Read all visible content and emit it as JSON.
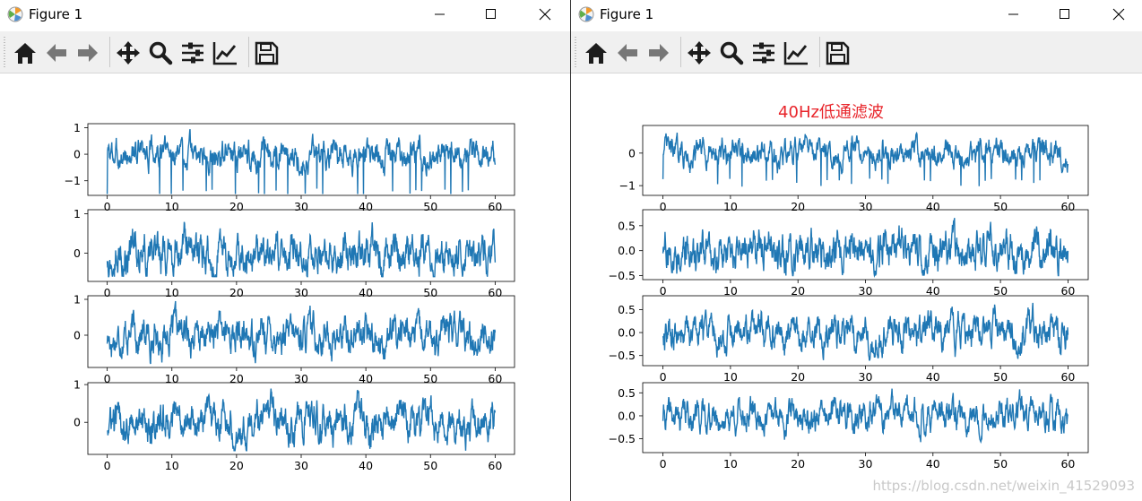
{
  "windows": [
    {
      "title": "Figure 1",
      "figure_title": "",
      "chart_data": [
        {
          "type": "line",
          "title": "",
          "xlabel": "",
          "ylabel": "",
          "xlim": [
            -3,
            63
          ],
          "ylim": [
            -1.55,
            1.15
          ],
          "x_ticks": [
            0,
            10,
            20,
            30,
            40,
            50,
            60
          ],
          "y_ticks": [
            1,
            0,
            -1
          ],
          "y_tick_labels": [
            "1",
            "0",
            "−1"
          ],
          "series": [
            {
              "x_range": [
                0,
                60
              ],
              "approx_min": -1.5,
              "approx_max": 1.0
            }
          ]
        },
        {
          "type": "line",
          "title": "",
          "xlabel": "",
          "ylabel": "",
          "xlim": [
            -3,
            63
          ],
          "ylim": [
            -0.72,
            1.1
          ],
          "x_ticks": [
            0,
            10,
            20,
            30,
            40,
            50,
            60
          ],
          "y_ticks": [
            1,
            0
          ],
          "y_tick_labels": [
            "1",
            "0"
          ],
          "series": [
            {
              "x_range": [
                0,
                60
              ],
              "approx_min": -0.6,
              "approx_max": 0.95
            }
          ]
        },
        {
          "type": "line",
          "title": "",
          "xlabel": "",
          "ylabel": "",
          "xlim": [
            -3,
            63
          ],
          "ylim": [
            -0.9,
            1.1
          ],
          "x_ticks": [
            0,
            10,
            20,
            30,
            40,
            50,
            60
          ],
          "y_ticks": [
            1,
            0
          ],
          "y_tick_labels": [
            "1",
            "0"
          ],
          "series": [
            {
              "x_range": [
                0,
                60
              ],
              "approx_min": -0.8,
              "approx_max": 0.95
            }
          ]
        },
        {
          "type": "line",
          "title": "",
          "xlabel": "",
          "ylabel": "",
          "xlim": [
            -3,
            63
          ],
          "ylim": [
            -0.85,
            1.05
          ],
          "x_ticks": [
            0,
            10,
            20,
            30,
            40,
            50,
            60
          ],
          "y_ticks": [
            1,
            0
          ],
          "y_tick_labels": [
            "1",
            "0"
          ],
          "series": [
            {
              "x_range": [
                0,
                60
              ],
              "approx_min": -0.75,
              "approx_max": 0.95
            }
          ]
        }
      ]
    },
    {
      "title": "Figure 1",
      "figure_title": "40Hz低通滤波",
      "chart_data": [
        {
          "type": "line",
          "title": "40Hz低通滤波",
          "xlabel": "",
          "ylabel": "",
          "xlim": [
            -3,
            63
          ],
          "ylim": [
            -1.3,
            0.85
          ],
          "x_ticks": [
            0,
            10,
            20,
            30,
            40,
            50,
            60
          ],
          "y_ticks": [
            0,
            -1
          ],
          "y_tick_labels": [
            "0",
            "−1"
          ],
          "series": [
            {
              "x_range": [
                0,
                60
              ],
              "approx_min": -1.2,
              "approx_max": 0.75
            }
          ]
        },
        {
          "type": "line",
          "title": "",
          "xlabel": "",
          "ylabel": "",
          "xlim": [
            -3,
            63
          ],
          "ylim": [
            -0.58,
            0.82
          ],
          "x_ticks": [
            0,
            10,
            20,
            30,
            40,
            50,
            60
          ],
          "y_ticks": [
            0.5,
            0.0,
            -0.5
          ],
          "y_tick_labels": [
            "0.5",
            "0.0",
            "−0.5"
          ],
          "series": [
            {
              "x_range": [
                0,
                60
              ],
              "approx_min": -0.5,
              "approx_max": 0.75
            }
          ]
        },
        {
          "type": "line",
          "title": "",
          "xlabel": "",
          "ylabel": "",
          "xlim": [
            -3,
            63
          ],
          "ylim": [
            -0.72,
            0.8
          ],
          "x_ticks": [
            0,
            10,
            20,
            30,
            40,
            50,
            60
          ],
          "y_ticks": [
            0.5,
            0.0,
            -0.5
          ],
          "y_tick_labels": [
            "0.5",
            "0.0",
            "−0.5"
          ],
          "series": [
            {
              "x_range": [
                0,
                60
              ],
              "approx_min": -0.6,
              "approx_max": 0.72
            }
          ]
        },
        {
          "type": "line",
          "title": "",
          "xlabel": "",
          "ylabel": "",
          "xlim": [
            -3,
            63
          ],
          "ylim": [
            -0.8,
            0.72
          ],
          "x_ticks": [
            0,
            10,
            20,
            30,
            40,
            50,
            60
          ],
          "y_ticks": [
            0.5,
            0.0,
            -0.5
          ],
          "y_tick_labels": [
            "0.5",
            "0.0",
            "−0.5"
          ],
          "series": [
            {
              "x_range": [
                0,
                60
              ],
              "approx_min": -0.7,
              "approx_max": 0.65
            }
          ]
        }
      ]
    }
  ],
  "toolbar_icons": [
    "home-icon",
    "back-arrow-icon",
    "forward-arrow-icon",
    "pan-icon",
    "zoom-icon",
    "subplots-icon",
    "edit-axis-icon",
    "save-icon"
  ],
  "window_controls": [
    "minimize-icon",
    "maximize-icon",
    "close-icon"
  ],
  "colors": {
    "line": "#1f77b4",
    "title": "#e8242a",
    "toolbar_bg": "#f0f0f0",
    "icon": "#1c1c1c"
  },
  "watermark": "https://blog.csdn.net/weixin_41529093"
}
